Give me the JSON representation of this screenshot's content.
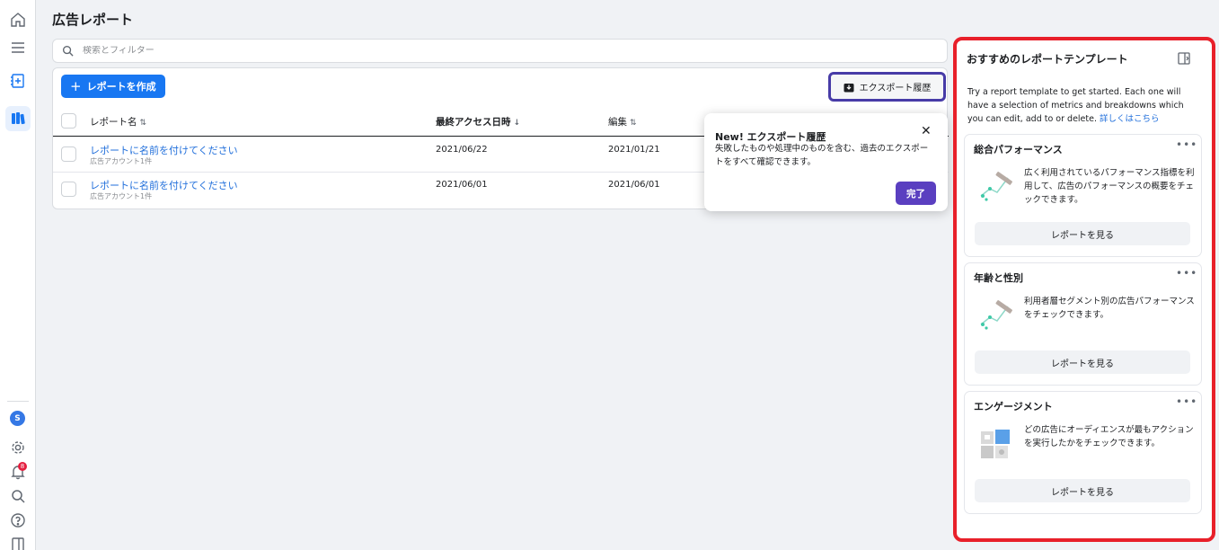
{
  "nav": {
    "items": [
      {
        "name": "home-icon"
      },
      {
        "name": "menu-icon"
      },
      {
        "name": "add-report-icon"
      },
      {
        "name": "reports-icon"
      }
    ],
    "avatar_initial": "S",
    "notification_count": "8",
    "bottom_icons": [
      "gear-icon",
      "bell-icon",
      "search-icon",
      "help-icon",
      "panel-icon"
    ]
  },
  "page": {
    "title": "広告レポート"
  },
  "search": {
    "placeholder": "検索とフィルター"
  },
  "toolbar": {
    "create_label": "レポートを作成",
    "export_label": "エクスポート履歴"
  },
  "table": {
    "columns": [
      {
        "label": "レポート名",
        "sort": "⇅"
      },
      {
        "label": "最終アクセス日時",
        "sort": "↓"
      },
      {
        "label": "編集",
        "sort": "⇅"
      }
    ],
    "rows": [
      {
        "name": "レポートに名前を付けてください",
        "sub": "広告アカウント1件",
        "last_access": "2021/06/22",
        "edited": "2021/01/21"
      },
      {
        "name": "レポートに名前を付けてください",
        "sub": "広告アカウント1件",
        "last_access": "2021/06/01",
        "edited": "2021/06/01"
      }
    ]
  },
  "tooltip": {
    "title": "New! エクスポート履歴",
    "body": "失敗したものや処理中のものを含む、過去のエクスポートをすべて確認できます。",
    "close": "✕",
    "done_label": "完了"
  },
  "templates": {
    "title": "おすすめのレポートテンプレート",
    "intro": "Try a report template to get started. Each one will have a selection of metrics and breakdowns which you can edit, add to or delete.",
    "intro_link": "詳しくはこちら",
    "more": "•••",
    "cards": [
      {
        "title": "総合パフォーマンス",
        "desc": "広く利用されているパフォーマンス指標を利用して、広告のパフォーマンスの概要をチェックできます。",
        "button": "レポートを見る"
      },
      {
        "title": "年齢と性別",
        "desc": "利用者層セグメント別の広告パフォーマンスをチェックできます。",
        "button": "レポートを見る"
      },
      {
        "title": "エンゲージメント",
        "desc": "どの広告にオーディエンスが最もアクションを実行したかをチェックできます。",
        "button": "レポートを見る"
      }
    ]
  },
  "colors": {
    "primary": "#1877f2",
    "link": "#216fdb",
    "done": "#5a3fc0",
    "highlight": "#e8202a"
  }
}
